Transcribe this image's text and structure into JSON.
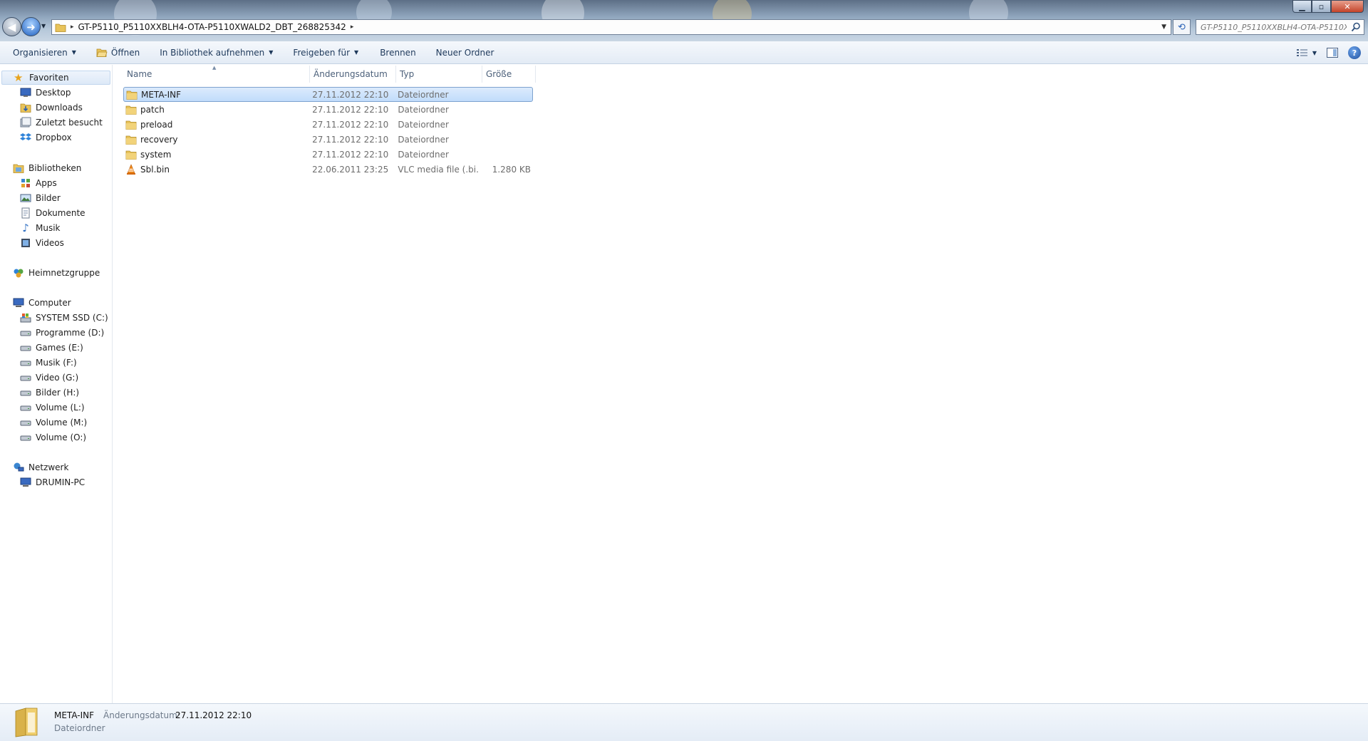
{
  "window": {
    "minimize_glyph": "▁",
    "maximize_glyph": "▫",
    "close_glyph": "✕"
  },
  "address": {
    "path": "GT-P5110_P5110XXBLH4-OTA-P5110XWALD2_DBT_268825342",
    "separator": "▸"
  },
  "search": {
    "placeholder": "GT-P5110_P5110XXBLH4-OTA-P5110X..."
  },
  "toolbar": {
    "organize": "Organisieren",
    "open": "Öffnen",
    "library": "In Bibliothek aufnehmen",
    "share": "Freigeben für",
    "burn": "Brennen",
    "new_folder": "Neuer Ordner"
  },
  "nav": {
    "favorites": "Favoriten",
    "desktop": "Desktop",
    "downloads": "Downloads",
    "recent": "Zuletzt besucht",
    "dropbox": "Dropbox",
    "libraries": "Bibliotheken",
    "apps": "Apps",
    "pictures": "Bilder",
    "documents": "Dokumente",
    "music": "Musik",
    "videos": "Videos",
    "homegroup": "Heimnetzgruppe",
    "computer": "Computer",
    "drive_c": "SYSTEM SSD (C:)",
    "drive_d": "Programme (D:)",
    "drive_e": "Games (E:)",
    "drive_f": "Musik (F:)",
    "drive_g": "Video (G:)",
    "drive_h": "Bilder (H:)",
    "drive_l": "Volume (L:)",
    "drive_m": "Volume (M:)",
    "drive_o": "Volume (O:)",
    "network": "Netzwerk",
    "pc": "DRUMIN-PC"
  },
  "columns": {
    "name": "Name",
    "date": "Änderungsdatum",
    "type": "Typ",
    "size": "Größe"
  },
  "files": [
    {
      "name": "META-INF",
      "date": "27.11.2012 22:10",
      "type": "Dateiordner",
      "size": ""
    },
    {
      "name": "patch",
      "date": "27.11.2012 22:10",
      "type": "Dateiordner",
      "size": ""
    },
    {
      "name": "preload",
      "date": "27.11.2012 22:10",
      "type": "Dateiordner",
      "size": ""
    },
    {
      "name": "recovery",
      "date": "27.11.2012 22:10",
      "type": "Dateiordner",
      "size": ""
    },
    {
      "name": "system",
      "date": "27.11.2012 22:10",
      "type": "Dateiordner",
      "size": ""
    },
    {
      "name": "Sbl.bin",
      "date": "22.06.2011 23:25",
      "type": "VLC media file (.bi...",
      "size": "1.280 KB"
    }
  ],
  "details": {
    "name": "META-INF",
    "date_label": "Änderungsdatum:",
    "date_value": "27.11.2012 22:10",
    "type": "Dateiordner"
  },
  "colors": {
    "accent": "#1e395b",
    "selection": "#c1dcfb",
    "folder": "#e8c35a"
  }
}
